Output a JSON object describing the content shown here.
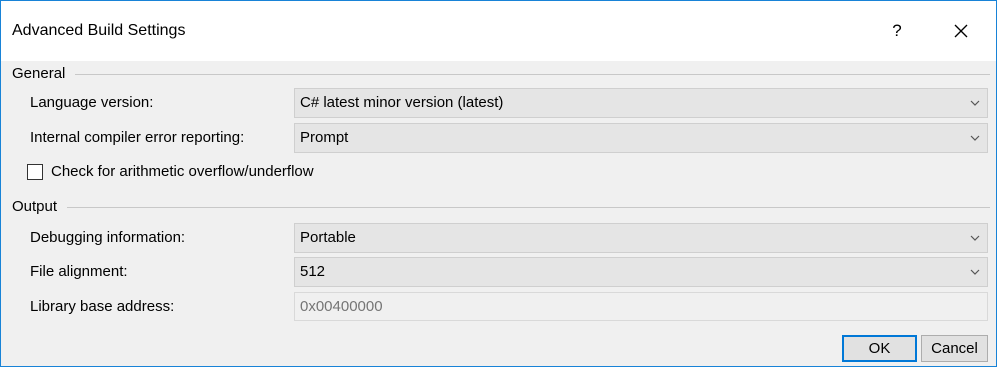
{
  "window": {
    "title": "Advanced Build Settings",
    "help_label": "?",
    "close_icon": "close-icon"
  },
  "general": {
    "header": "General",
    "language_version": {
      "label": "Language version:",
      "value": "C# latest minor version (latest)"
    },
    "compiler_error_reporting": {
      "label": "Internal compiler error reporting:",
      "value": "Prompt"
    },
    "arithmetic_overflow": {
      "label": "Check for arithmetic overflow/underflow",
      "checked": false
    }
  },
  "output": {
    "header": "Output",
    "debugging_information": {
      "label": "Debugging information:",
      "value": "Portable"
    },
    "file_alignment": {
      "label": "File alignment:",
      "value": "512"
    },
    "library_base_address": {
      "label": "Library base address:",
      "placeholder": "0x00400000"
    }
  },
  "buttons": {
    "ok": "OK",
    "cancel": "Cancel"
  },
  "colors": {
    "window_border": "#1883d7",
    "default_button_border": "#0078d7",
    "dialog_background": "#f0f0f0"
  }
}
